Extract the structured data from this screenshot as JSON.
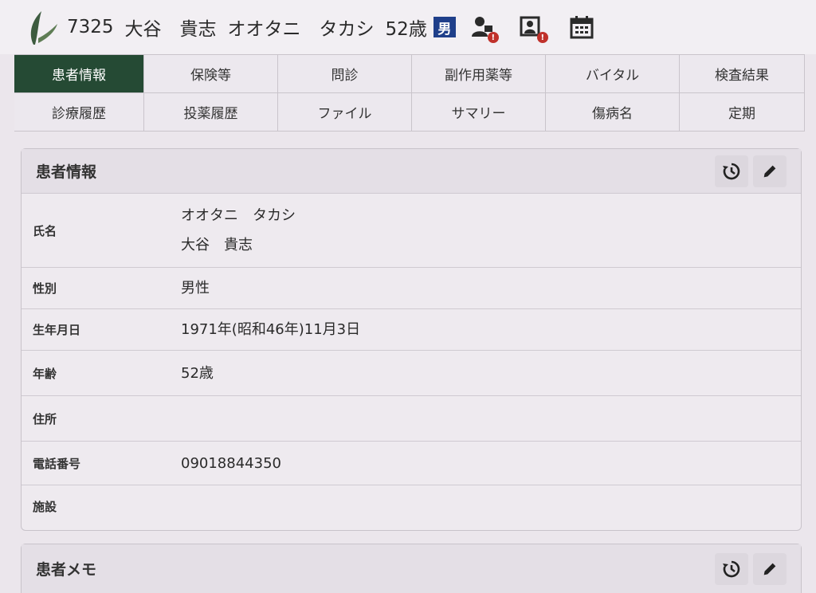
{
  "header": {
    "patient_id": "7325",
    "name_kanji": "大谷　貴志",
    "name_kana": "オオタニ　タカシ",
    "age": "52歳",
    "gender_badge": "男",
    "icons": [
      "user-alert-icon",
      "user-card-alert-icon",
      "calendar-icon"
    ],
    "badge_mark": "!"
  },
  "tabs": {
    "row1": [
      "患者情報",
      "保険等",
      "問診",
      "副作用薬等",
      "バイタル",
      "検査結果"
    ],
    "row2": [
      "診療履歴",
      "投薬履歴",
      "ファイル",
      "サマリー",
      "傷病名",
      "定期"
    ]
  },
  "patient_panel": {
    "title": "患者情報",
    "rows": [
      {
        "label": "氏名",
        "value_line1": "オオタニ　タカシ",
        "value_line2": "大谷　貴志"
      },
      {
        "label": "性別",
        "value": "男性"
      },
      {
        "label": "生年月日",
        "value": "1971年(昭和46年)11月3日"
      },
      {
        "label": "年齢",
        "value": "52歳"
      },
      {
        "label": "住所",
        "value": ""
      },
      {
        "label": "電話番号",
        "value": "09018844350"
      },
      {
        "label": "施設",
        "value": ""
      }
    ]
  },
  "memo_panel": {
    "title": "患者メモ"
  },
  "colors": {
    "active_tab": "#254a34",
    "gender_badge": "#1f3f8a",
    "alert_dot": "#c0312b"
  }
}
